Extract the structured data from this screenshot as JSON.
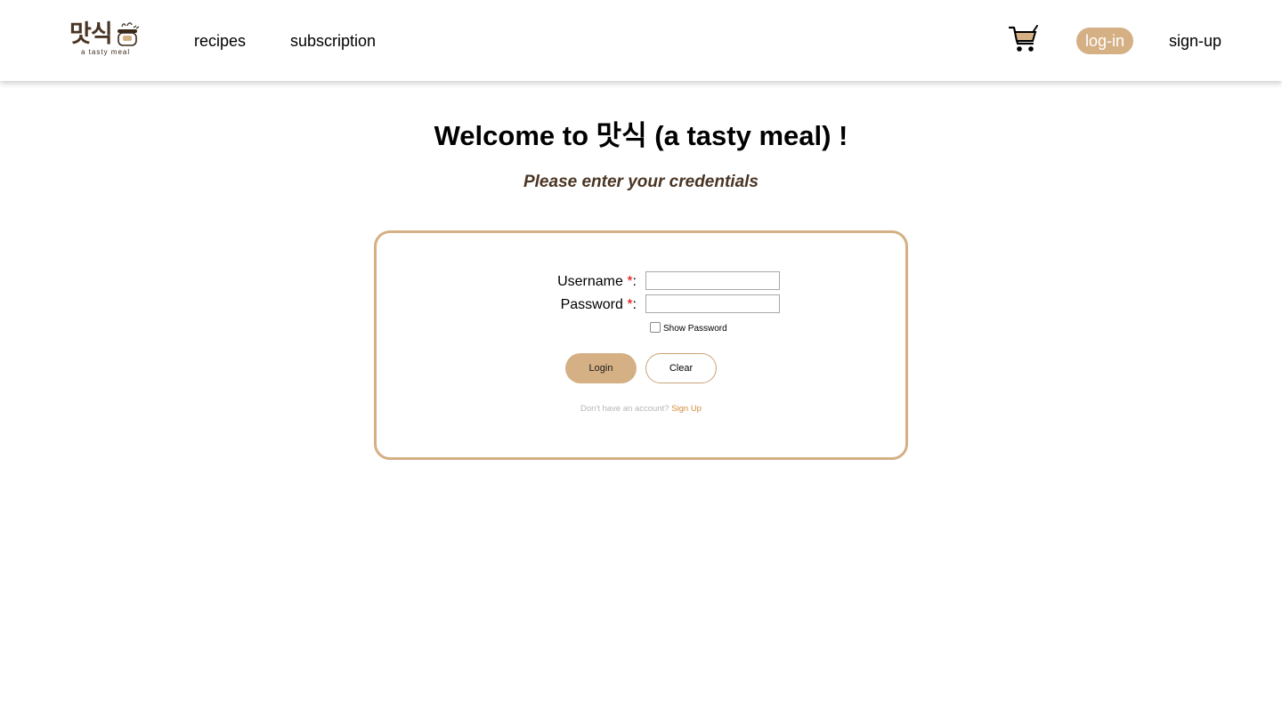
{
  "header": {
    "logo_text": "맛식",
    "logo_sub": "a tasty meal",
    "nav": {
      "recipes": "recipes",
      "subscription": "subscription"
    },
    "cart_icon": "shopping-cart-icon",
    "login": "log-in",
    "signup": "sign-up",
    "accent_color": "#d5b085"
  },
  "main": {
    "title_pre": "Welcome to ",
    "title_ko": "맛식",
    "title_post": " (a tasty meal) !",
    "subtitle": "Please enter your credentials"
  },
  "form": {
    "username_label": "Username ",
    "password_label": "Password ",
    "required_mark": "*",
    "colon": ":",
    "username_value": "",
    "password_value": "",
    "show_password_label": "Show Password",
    "show_password_checked": false,
    "login_button": "Login",
    "clear_button": "Clear",
    "footer_text": "Don't have an account? ",
    "footer_link": "Sign Up"
  }
}
